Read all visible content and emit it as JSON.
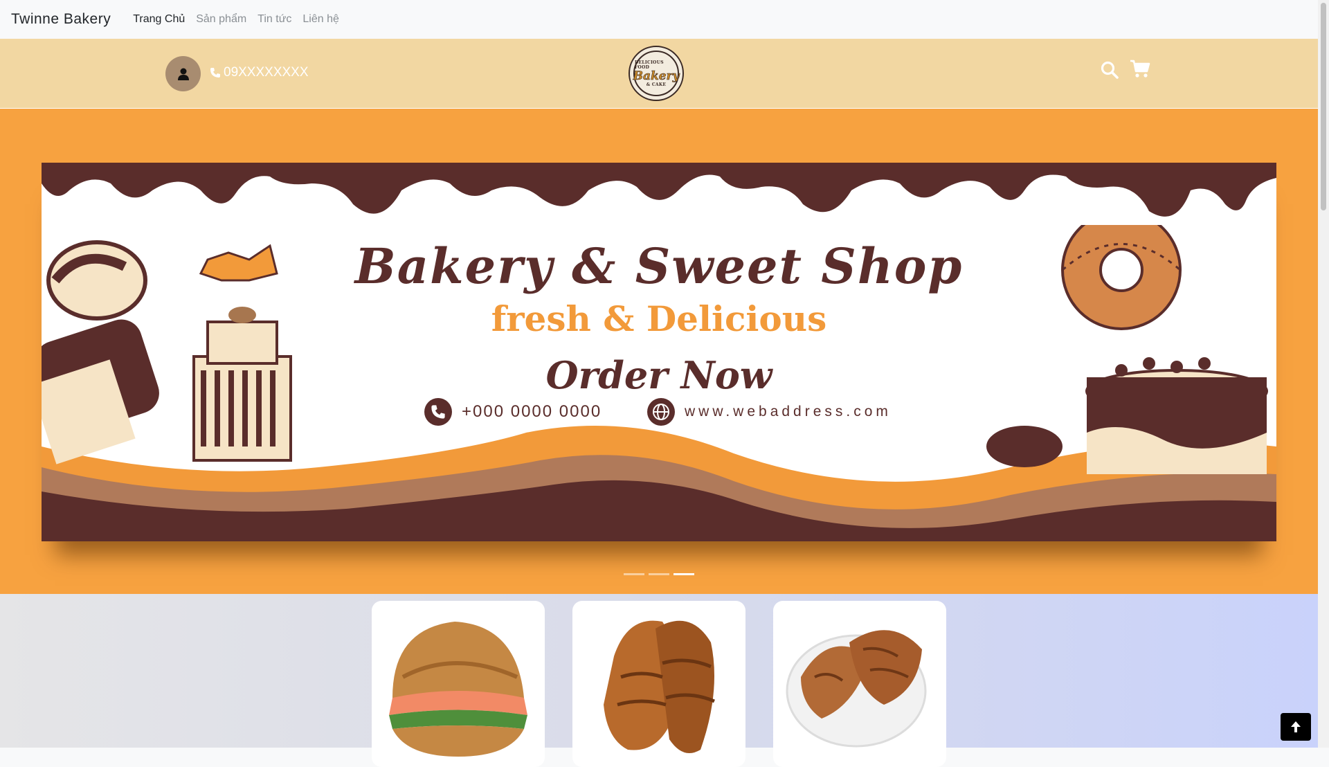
{
  "navbar": {
    "brand": "Twinne Bakery",
    "links": [
      "Trang Chủ",
      "Sản phẩm",
      "Tin tức",
      "Liên hệ"
    ]
  },
  "header": {
    "phone": "09XXXXXXXX",
    "logo_top_text": "DELICIOUS FOOD",
    "logo_main_text": "Bakery",
    "logo_sub_text": "& CAKE",
    "icons": [
      "user-icon",
      "phone-icon",
      "search-icon",
      "cart-icon"
    ]
  },
  "banner": {
    "title": "Bakery & Sweet Shop",
    "subtitle": "fresh & Delicious",
    "cta": "Order Now",
    "phone": "+000 0000 0000",
    "web": "www.webaddress.com",
    "slides": 3,
    "active_slide": 3
  },
  "products": [
    {
      "name": "salmon croissant sandwich"
    },
    {
      "name": "chocolate croissant"
    },
    {
      "name": "croissants on plate"
    }
  ],
  "colors": {
    "header_bg": "#f2d7a2",
    "hero_bg": "#f7a240",
    "chocolate": "#5a2d2b",
    "accent_orange": "#f29a3a"
  }
}
